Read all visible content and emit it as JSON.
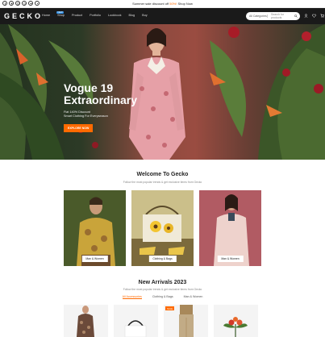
{
  "topbar": {
    "socials": [
      "facebook-icon",
      "twitter-icon",
      "instagram-icon",
      "pinterest-icon",
      "behance-icon",
      "youtube-icon"
    ],
    "promo_prefix": "Summer sale discount off ",
    "promo_highlight": "50%!",
    "promo_suffix": " Shop Now"
  },
  "nav": {
    "logo": "GECKO",
    "items": [
      "Home",
      "Shop",
      "Product",
      "Portfolio",
      "Lookbook",
      "Blog",
      "Buy"
    ],
    "badge": "NEW",
    "search_category": "All Categories",
    "search_placeholder": "Search for products"
  },
  "hero": {
    "title_line1": "Vogue 19",
    "title_line2": "Extraordinary",
    "subtitle_line1": "Flat 140% Discount",
    "subtitle_line2": "Smart Clothing For Everyseason",
    "button": "EXPLORE NOW"
  },
  "welcome": {
    "title": "Welcome To Gecko",
    "subtitle": "Follow the most popular trends & get exclusive items from Gecko",
    "cards": [
      "Man & Women",
      "Clothing & Bags",
      "Man & Women"
    ]
  },
  "arrivals": {
    "title": "New Arrivals 2023",
    "subtitle": "Follow the most popular trends & get exclusive items from Gecko",
    "tabs": [
      "All Accessories",
      "Clothing & Bags",
      "Man & Women"
    ],
    "sale_badge": "SALE"
  },
  "colors": {
    "accent": "#ff6a00",
    "nav_bg": "#1a1a1a",
    "badge": "#2e8be0"
  }
}
